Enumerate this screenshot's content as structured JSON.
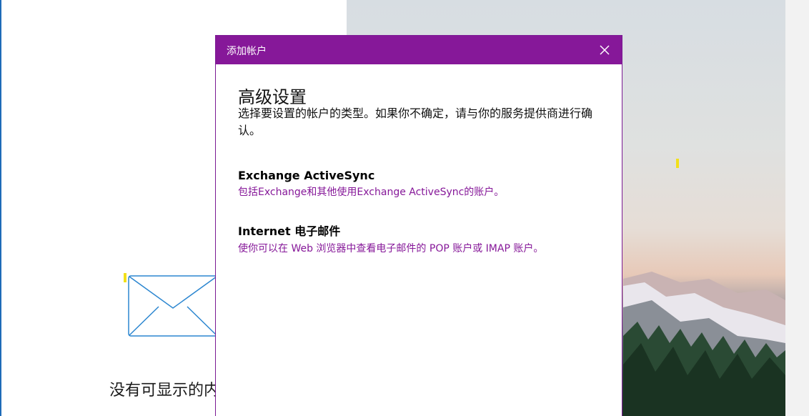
{
  "dialog": {
    "title": "添加帐户",
    "heading": "高级设置",
    "description": "选择要设置的帐户的类型。如果你不确定，请与你的服务提供商进行确认。",
    "options": [
      {
        "title": "Exchange ActiveSync",
        "subtitle": "包括Exchange和其他使用Exchange ActiveSync的账户。"
      },
      {
        "title": "Internet 电子邮件",
        "subtitle": "使你可以在 Web 浏览器中查看电子邮件的 POP 账户或 IMAP 账户。"
      }
    ],
    "close_icon": "close-icon"
  },
  "background": {
    "empty_message": "没有可显示的内",
    "envelope_icon": "envelope-icon"
  },
  "colors": {
    "accent": "#861899",
    "link": "#861899",
    "envelope_stroke": "#2b86d0"
  }
}
